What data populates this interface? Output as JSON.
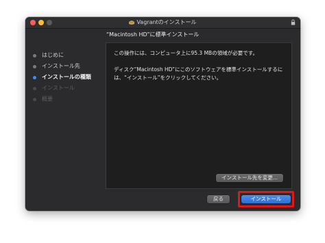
{
  "window": {
    "title": "Vagrantのインストール",
    "subtitle": "“Macintosh HD”に標準インストール"
  },
  "traffic_lights": {
    "close_color": "#ff5f57",
    "minimize_color": "#febc2e",
    "zoom_color": "#5a5a5c"
  },
  "icons": {
    "app": "package-icon",
    "lock": "lock-icon"
  },
  "sidebar": {
    "items": [
      {
        "label": "はじめに",
        "state": "done"
      },
      {
        "label": "インストール先",
        "state": "done"
      },
      {
        "label": "インストールの種類",
        "state": "current"
      },
      {
        "label": "インストール",
        "state": "future"
      },
      {
        "label": "概要",
        "state": "future"
      }
    ],
    "dot_colors": {
      "done": "#7a7a7c",
      "current": "#3d8ef2",
      "future": "#4a4a4c"
    }
  },
  "content": {
    "line1": "この操作には、コンピュータ上に95.3 MBの領域が必要です。",
    "line2": "ディスク“Macintosh HD”にこのソフトウェアを標準インストールするには、“インストール”をクリックしてください。"
  },
  "buttons": {
    "change_location": "インストール先を変更...",
    "back": "戻る",
    "install": "インストール"
  },
  "annotation": {
    "highlight_color": "#e01818"
  }
}
